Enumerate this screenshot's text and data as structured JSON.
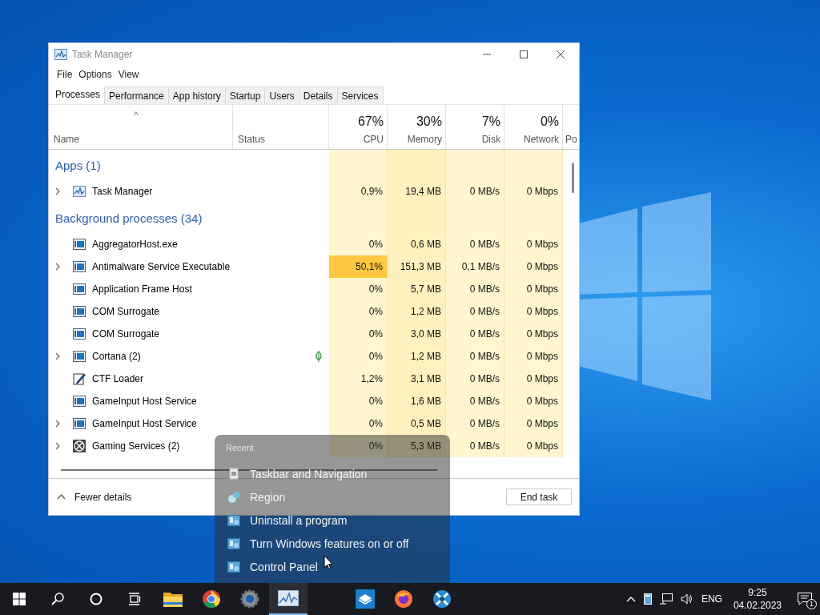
{
  "window": {
    "title": "Task Manager"
  },
  "menu": [
    "File",
    "Options",
    "View"
  ],
  "tabs": [
    {
      "label": "Processes",
      "selected": true
    },
    {
      "label": "Performance",
      "selected": false
    },
    {
      "label": "App history",
      "selected": false
    },
    {
      "label": "Startup",
      "selected": false
    },
    {
      "label": "Users",
      "selected": false
    },
    {
      "label": "Details",
      "selected": false
    },
    {
      "label": "Services",
      "selected": false
    }
  ],
  "table": {
    "sort_indicator": "^",
    "columns": [
      {
        "label": "Name"
      },
      {
        "label": "Status"
      },
      {
        "label": "CPU",
        "total": "67%"
      },
      {
        "label": "Memory",
        "total": "30%"
      },
      {
        "label": "Disk",
        "total": "7%"
      },
      {
        "label": "Network",
        "total": "0%"
      },
      {
        "label": "Po"
      }
    ],
    "groups": [
      {
        "title": "Apps (1)",
        "rows": [
          {
            "name": "Task Manager",
            "kind": "chart",
            "expandable": true,
            "suspended": false,
            "cpu_hot": false,
            "values": [
              "0,9%",
              "19,4 MB",
              "0 MB/s",
              "0 Mbps"
            ]
          }
        ]
      },
      {
        "title": "Background processes (34)",
        "rows": [
          {
            "name": "AggregatorHost.exe",
            "kind": "window",
            "expandable": false,
            "suspended": false,
            "cpu_hot": false,
            "values": [
              "0%",
              "0,6 MB",
              "0 MB/s",
              "0 Mbps"
            ]
          },
          {
            "name": "Antimalware Service Executable",
            "kind": "window",
            "expandable": true,
            "suspended": false,
            "cpu_hot": true,
            "values": [
              "50,1%",
              "151,3 MB",
              "0,1 MB/s",
              "0 Mbps"
            ]
          },
          {
            "name": "Application Frame Host",
            "kind": "window",
            "expandable": false,
            "suspended": false,
            "cpu_hot": false,
            "values": [
              "0%",
              "5,7 MB",
              "0 MB/s",
              "0 Mbps"
            ]
          },
          {
            "name": "COM Surrogate",
            "kind": "window",
            "expandable": false,
            "suspended": false,
            "cpu_hot": false,
            "values": [
              "0%",
              "1,2 MB",
              "0 MB/s",
              "0 Mbps"
            ]
          },
          {
            "name": "COM Surrogate",
            "kind": "window",
            "expandable": false,
            "suspended": false,
            "cpu_hot": false,
            "values": [
              "0%",
              "3,0 MB",
              "0 MB/s",
              "0 Mbps"
            ]
          },
          {
            "name": "Cortana (2)",
            "kind": "window",
            "expandable": true,
            "suspended": true,
            "cpu_hot": false,
            "values": [
              "0%",
              "1,2 MB",
              "0 MB/s",
              "0 Mbps"
            ]
          },
          {
            "name": "CTF Loader",
            "kind": "pen",
            "expandable": false,
            "suspended": false,
            "cpu_hot": false,
            "values": [
              "1,2%",
              "3,1 MB",
              "0 MB/s",
              "0 Mbps"
            ]
          },
          {
            "name": "GameInput Host Service",
            "kind": "window",
            "expandable": false,
            "suspended": false,
            "cpu_hot": false,
            "values": [
              "0%",
              "1,6 MB",
              "0 MB/s",
              "0 Mbps"
            ]
          },
          {
            "name": "GameInput Host Service",
            "kind": "window",
            "expandable": true,
            "suspended": false,
            "cpu_hot": false,
            "values": [
              "0%",
              "0,5 MB",
              "0 MB/s",
              "0 Mbps"
            ]
          },
          {
            "name": "Gaming Services (2)",
            "kind": "xbox",
            "expandable": true,
            "suspended": false,
            "cpu_hot": false,
            "values": [
              "0%",
              "5,3 MB",
              "0 MB/s",
              "0 Mbps"
            ]
          }
        ]
      }
    ]
  },
  "footer": {
    "fewer_details": "Fewer details",
    "end_task": "End task"
  },
  "jump_list": {
    "header": "Recent",
    "items": [
      {
        "label": "Taskbar and Navigation",
        "kind": "settings"
      },
      {
        "label": "Region",
        "kind": "globe"
      },
      {
        "label": "Uninstall a program",
        "kind": "panel"
      },
      {
        "label": "Turn Windows features on or off",
        "kind": "panel"
      },
      {
        "label": "Control Panel",
        "kind": "panel"
      }
    ]
  },
  "taskbar": {
    "apps": [
      {
        "kind": "folder",
        "active": false
      },
      {
        "kind": "browser",
        "active": false
      },
      {
        "kind": "gear",
        "active": false
      },
      {
        "kind": "chart",
        "active": true
      },
      {
        "kind": "box",
        "active": false
      },
      {
        "kind": "fox",
        "active": false
      },
      {
        "kind": "star",
        "active": false
      }
    ],
    "language": "ENG",
    "time": "9:25",
    "date": "04.02.2023",
    "notifications": "1"
  }
}
